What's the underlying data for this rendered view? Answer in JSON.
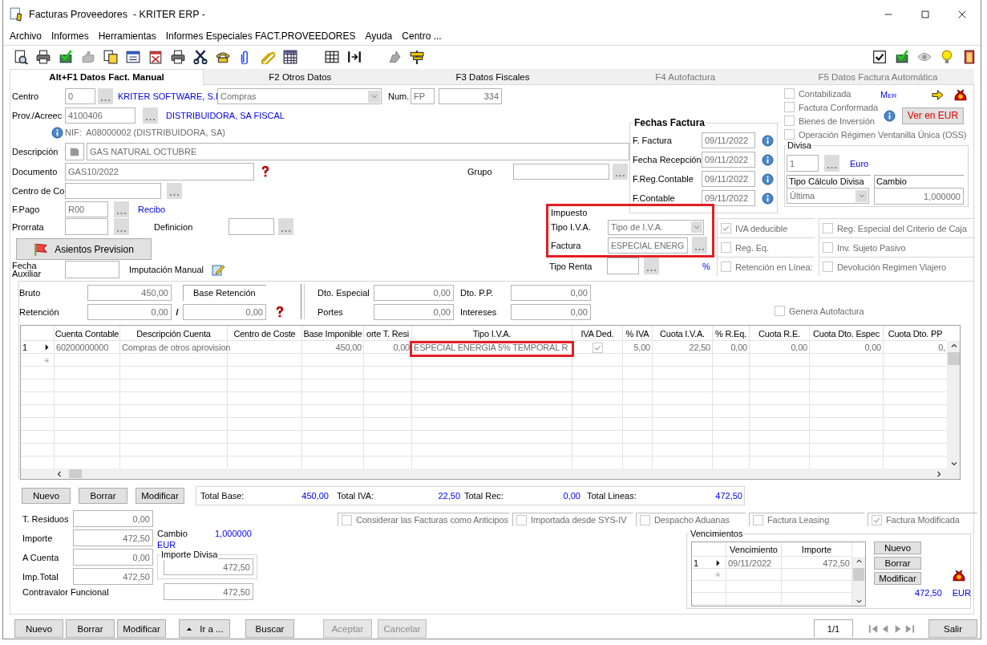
{
  "window": {
    "title": "Facturas Proveedores  - KRITER ERP -"
  },
  "menu": [
    "Archivo",
    "Informes",
    "Herramientas",
    "Informes Especiales FACT.PROVEEDORES",
    "Ayuda",
    "Centro ..."
  ],
  "tabs": [
    {
      "label": "Alt+F1 Datos Fact. Manual",
      "selected": true,
      "disabled": false
    },
    {
      "label": "F2 Otros Datos",
      "selected": false,
      "disabled": false
    },
    {
      "label": "F3 Datos Fiscales",
      "selected": false,
      "disabled": false
    },
    {
      "label": "F4 Autofactura",
      "selected": false,
      "disabled": true
    },
    {
      "label": "F5 Datos Factura Automática",
      "selected": false,
      "disabled": true
    }
  ],
  "header": {
    "centro": {
      "label": "Centro",
      "value": "0",
      "name": "KRITER SOFTWARE, S.I",
      "serie": "Compras"
    },
    "num": {
      "label": "Num.",
      "serie": "FP",
      "value": "334"
    },
    "proveedor": {
      "label": "Prov./Acreec",
      "value": "4100406",
      "name": "DISTRIBUIDORA, SA FISCAL"
    },
    "nif": "NIF:  A08000002 (DISTRIBUIDORA, SA)",
    "descripcion": {
      "label": "Descripción",
      "value": "GAS NATURAL OCTUBRE"
    },
    "documento": {
      "label": "Documento",
      "value": "GAS10/2022"
    },
    "grupo": {
      "label": "Grupo"
    },
    "centro_coste": {
      "label": "Centro de Co"
    },
    "forma_pago": {
      "label": "F.Pago",
      "value": "R00",
      "name": "Recibo"
    },
    "prorrata": {
      "label": "Prorrata"
    },
    "definicion": {
      "label": "Definicion"
    },
    "asientos_button": "Asientos Prevision",
    "fecha_auxiliar": {
      "label": "Fecha Auxiliar"
    },
    "imputacion_manual": "Imputación Manual"
  },
  "flags": [
    {
      "label": "Contabilizada",
      "checked": false
    },
    {
      "label": "Factura Conformada",
      "checked": false
    },
    {
      "label": "Bienes de Inversión",
      "checked": false
    },
    {
      "label": "Operación Régimen Ventanilla Única (OSS)",
      "checked": false
    }
  ],
  "mer": "Mer",
  "ver_en_eur_button": "Ver en EUR",
  "fechas_factura": {
    "title": "Fechas Factura",
    "rows": [
      {
        "label": "F. Factura",
        "value": "09/11/2022"
      },
      {
        "label": "Fecha Recepción",
        "value": "09/11/2022"
      },
      {
        "label": "F.Reg.Contable",
        "value": "09/11/2022"
      },
      {
        "label": "F.Contable",
        "value": "09/11/2022"
      }
    ]
  },
  "divisa": {
    "title": "Divisa",
    "code": "1",
    "name": "Euro",
    "tipo_calculo": {
      "label": "Tipo Cálculo Divisa",
      "value": "Última"
    },
    "cambio": {
      "label": "Cambio",
      "value": "1,000000"
    }
  },
  "impuesto": {
    "title": "Impuesto",
    "highlighted": true,
    "tipo_iva": {
      "label": "Tipo I.V.A.",
      "value": "Tipo de I.V.A."
    },
    "factura": {
      "label": "Factura",
      "value": "ESPECIAL ENERG"
    }
  },
  "tipo_renta": {
    "label": "Tipo Renta",
    "unit": "%"
  },
  "options": [
    {
      "label": "IVA deducible",
      "checked": true
    },
    {
      "label": "Reg. Especial del Criterio de Caja",
      "checked": false
    },
    {
      "label": "Reg. Eq.",
      "checked": false
    },
    {
      "label": "Inv. Sujeto Pasivo",
      "checked": false
    },
    {
      "label": "Retención en Línea:",
      "checked": false
    },
    {
      "label": "Devolución Regimen Viajero",
      "checked": false
    }
  ],
  "importes": {
    "bruto": {
      "label": "Bruto",
      "value": "450,00"
    },
    "base_retencion": "Base Retención",
    "retencion": {
      "label": "Retención",
      "value": "0,00",
      "separator": "/",
      "base": "0,00"
    },
    "dto_especial": {
      "label": "Dto. Especial",
      "value": "0,00"
    },
    "dto_pp": {
      "label": "Dto. P.P.",
      "value": "0,00"
    },
    "portes": {
      "label": "Portes",
      "value": "0,00"
    },
    "intereses": {
      "label": "Intereses",
      "value": "0,00"
    }
  },
  "genera_autofactura": {
    "label": "Genera Autofactura",
    "checked": false
  },
  "lines": {
    "columns": [
      {
        "label": "Cuenta Contable",
        "kind": "text"
      },
      {
        "label": "Descripción Cuenta",
        "kind": "text"
      },
      {
        "label": "Centro de Coste",
        "kind": "text"
      },
      {
        "label": "Base Imponible",
        "kind": "number"
      },
      {
        "label": "orte T. Resi",
        "kind": "number"
      },
      {
        "label": "Tipo I.V.A.",
        "kind": "text",
        "highlighted": true
      },
      {
        "label": "IVA Ded.",
        "kind": "check"
      },
      {
        "label": "% IVA",
        "kind": "number"
      },
      {
        "label": "Cuota I.V.A.",
        "kind": "number"
      },
      {
        "label": "% R.Eq.",
        "kind": "number"
      },
      {
        "label": "Cuota R.E.",
        "kind": "number"
      },
      {
        "label": "Cuota Dto. Espec",
        "kind": "number"
      },
      {
        "label": "Cuota Dto. PP",
        "kind": "number"
      }
    ],
    "rows": [
      {
        "number": "1",
        "current": true,
        "cells": [
          "60200000000",
          "Compras de otros aprovision",
          null,
          "450,00",
          "0,00",
          "ESPECIAL ENERGIA 5% TEMPORAL R",
          true,
          "5,00",
          "22,50",
          "0,00",
          "0,00",
          "0,00",
          "0,"
        ]
      }
    ]
  },
  "line_buttons": [
    "Nuevo",
    "Borrar",
    "Modificar"
  ],
  "totals": [
    {
      "label": "Total Base:",
      "value": "450,00"
    },
    {
      "label": "Total IVA:",
      "value": "22,50"
    },
    {
      "label": "Total Rec:",
      "value": "0,00"
    },
    {
      "label": "Total Lineas:",
      "value": "472,50"
    }
  ],
  "bottom_flags": [
    {
      "label": "Considerar las Facturas como Anticipos",
      "checked": false
    },
    {
      "label": "Importada desde SYS-IV",
      "checked": false
    },
    {
      "label": "Despacho Aduanas",
      "checked": false
    },
    {
      "label": "Factura Leasing",
      "checked": false
    },
    {
      "label": "Factura Modificada",
      "checked": true
    }
  ],
  "amounts": {
    "rows": [
      {
        "label": "T. Residuos",
        "value": "0,00"
      },
      {
        "label": "Importe",
        "value": "472,50"
      },
      {
        "label": "A Cuenta",
        "value": "0,00"
      },
      {
        "label": "Imp.Total",
        "value": "472,50"
      }
    ],
    "cambio": {
      "label": "Cambio",
      "value": "1,000000",
      "currency": "EUR"
    },
    "importe_divisa": {
      "title": "Importe Divisa",
      "value": "472,50"
    },
    "contravalor": {
      "label": "Contravalor Funcional",
      "value": "472,50"
    }
  },
  "vencimientos": {
    "title": "Vencimientos",
    "columns": [
      "Vencimiento",
      "Importe"
    ],
    "rows": [
      {
        "number": "1",
        "current": true,
        "cells": [
          "09/11/2022",
          "472,50"
        ]
      }
    ],
    "buttons": [
      "Nuevo",
      "Borrar",
      "Modificar"
    ],
    "total": "472,50",
    "currency": "EUR"
  },
  "footer": {
    "buttons": [
      {
        "label": "Nuevo",
        "kind": "plain",
        "disabled": false
      },
      {
        "label": "Borrar",
        "kind": "plain",
        "disabled": false
      },
      {
        "label": "Modificar",
        "kind": "plain",
        "disabled": false
      },
      {
        "label": "Ir a ...",
        "kind": "menu",
        "disabled": false
      },
      {
        "label": "Buscar",
        "kind": "plain",
        "disabled": false
      },
      {
        "label": "Aceptar",
        "kind": "plain",
        "disabled": true
      },
      {
        "label": "Cancelar",
        "kind": "plain",
        "disabled": true
      }
    ],
    "record": "1/1",
    "exit": "Salir"
  }
}
